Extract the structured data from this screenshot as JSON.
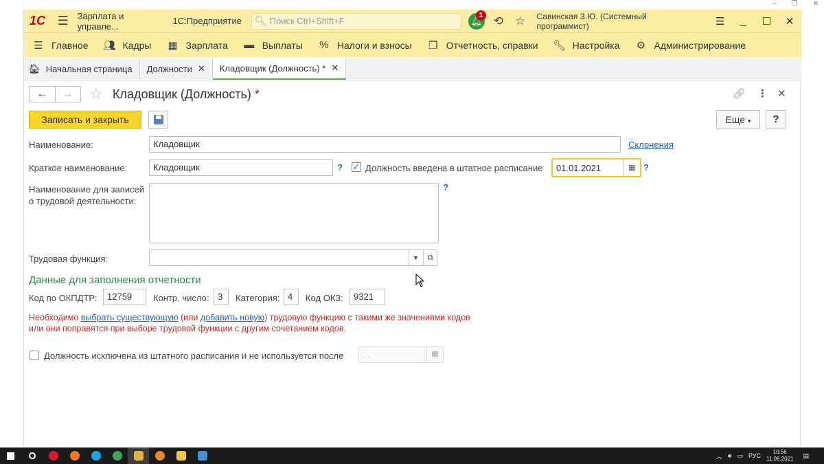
{
  "titlebar": {
    "logo": "1С",
    "app_title": "Зарплата и управле...",
    "platform": "1С:Предприятие",
    "search_placeholder": "Поиск Ctrl+Shift+F",
    "notification_count": "1",
    "user": "Савинская З.Ю. (Системный программист)"
  },
  "menu": [
    {
      "label": "Главное",
      "icon": "hamburger-icon"
    },
    {
      "label": "Кадры",
      "icon": "people-icon"
    },
    {
      "label": "Зарплата",
      "icon": "calculator-icon"
    },
    {
      "label": "Выплаты",
      "icon": "wallet-icon"
    },
    {
      "label": "Налоги и взносы",
      "icon": "percent-icon"
    },
    {
      "label": "Отчетность, справки",
      "icon": "documents-icon"
    },
    {
      "label": "Настройка",
      "icon": "wrench-icon"
    },
    {
      "label": "Администрирование",
      "icon": "gear-icon"
    }
  ],
  "tabs": {
    "home": "Начальная страница",
    "positions": "Должности",
    "current": "Кладовщик (Должность) *"
  },
  "form": {
    "title": "Кладовщик (Должность) *",
    "save_close": "Записать и закрыть",
    "more": "Еще",
    "help": "?",
    "name_label": "Наименование:",
    "name_value": "Кладовщик",
    "declensions_link": "Склонения",
    "short_label": "Краткое наименование:",
    "short_value": "Кладовщик",
    "staffing_label": "Должность введена в штатное расписание",
    "staffing_checked": true,
    "staffing_date": "01.01.2021",
    "labor_record_label_1": "Наименование для записей",
    "labor_record_label_2": "о трудовой деятельности:",
    "labor_record_value": "",
    "labor_function_label": "Трудовая функция:",
    "labor_function_value": "",
    "section_title": "Данные для заполнения отчетности",
    "okpdtr_label": "Код по ОКПДТР:",
    "okpdtr_value": "12759",
    "control_label": "Контр. число:",
    "control_value": "3",
    "category_label": "Категория:",
    "category_value": "4",
    "okz_label": "Код ОКЗ:",
    "okz_value": "9321",
    "warn_1a": "Необходимо ",
    "warn_link1": "выбрать существующую",
    "warn_1b": " (или ",
    "warn_link2": "добавить новую",
    "warn_1c": ") трудовую функцию с такими же значениями кодов",
    "warn_2": "или они поправятся при выборе трудовой функции с другим сочетанием кодов.",
    "excluded_label": "Должность исключена из штатного расписания и не используется после",
    "excluded_checked": false,
    "excluded_date_placeholder": " .  . "
  },
  "tray": {
    "lang": "РУС",
    "time": "10:56",
    "date": "11.08.2021"
  },
  "colors": {
    "header_bg": "#fbeda3",
    "accent_button": "#f8d529",
    "section_green": "#2c8a4e",
    "warning_red": "#d12424",
    "link_blue": "#1f5fbf"
  }
}
